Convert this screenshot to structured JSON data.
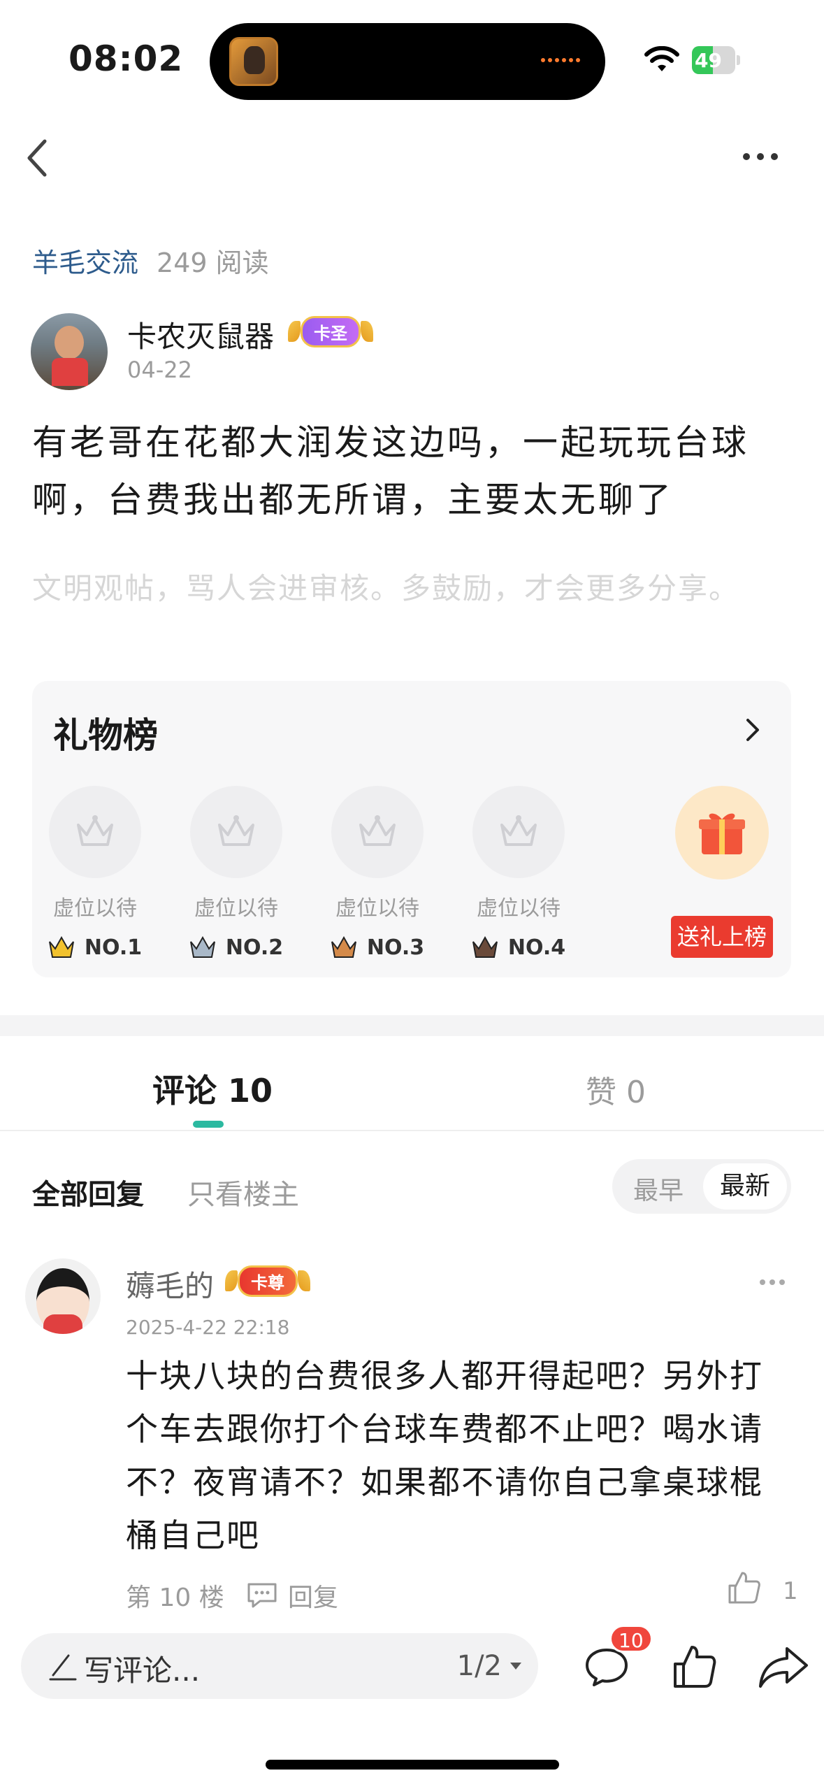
{
  "status_bar": {
    "time": "08:02",
    "battery": "49",
    "battery_level": 0.49
  },
  "post": {
    "forum": "羊毛交流",
    "read_count": "249 阅读",
    "author": {
      "name": "卡农灭鼠器",
      "badge": "卡圣",
      "date": "04-22"
    },
    "content": "有老哥在花都大润发这边吗，一起玩玩台球啊，台费我出都无所谓，主要太无聊了",
    "civil_note": "文明观帖，骂人会进审核。多鼓励，才会更多分享。"
  },
  "gift_board": {
    "title": "礼物榜",
    "slots": [
      {
        "label": "虚位以待",
        "rank": "NO.1",
        "crown_color": "#f2c22e"
      },
      {
        "label": "虚位以待",
        "rank": "NO.2",
        "crown_color": "#a9b8c8"
      },
      {
        "label": "虚位以待",
        "rank": "NO.3",
        "crown_color": "#d48a4a"
      },
      {
        "label": "虚位以待",
        "rank": "NO.4",
        "crown_color": "#6a4a3a"
      }
    ],
    "send_label": "送礼上榜"
  },
  "tabs": {
    "comments": "评论 10",
    "likes": "赞 0"
  },
  "filters": {
    "all": "全部回复",
    "op_only": "只看楼主",
    "sort_early": "最早",
    "sort_new": "最新"
  },
  "comment": {
    "name": "薅毛的",
    "badge": "卡尊",
    "date": "2025-4-22 22:18",
    "text": "十块八块的台费很多人都开得起吧？另外打个车去跟你打个台球车费都不止吧？喝水请不？夜宵请不？如果都不请你自己拿桌球棍桶自己吧",
    "floor": "第 10 楼",
    "reply": "回复",
    "likes": "1"
  },
  "bottom_bar": {
    "placeholder": "写评论...",
    "page": "1/2",
    "comment_count": "10"
  },
  "colors": {
    "accent": "#2bb9a0",
    "link": "#2d5b8c",
    "gift_button": "#ea3b2f",
    "badge_red": "#f0463c"
  }
}
